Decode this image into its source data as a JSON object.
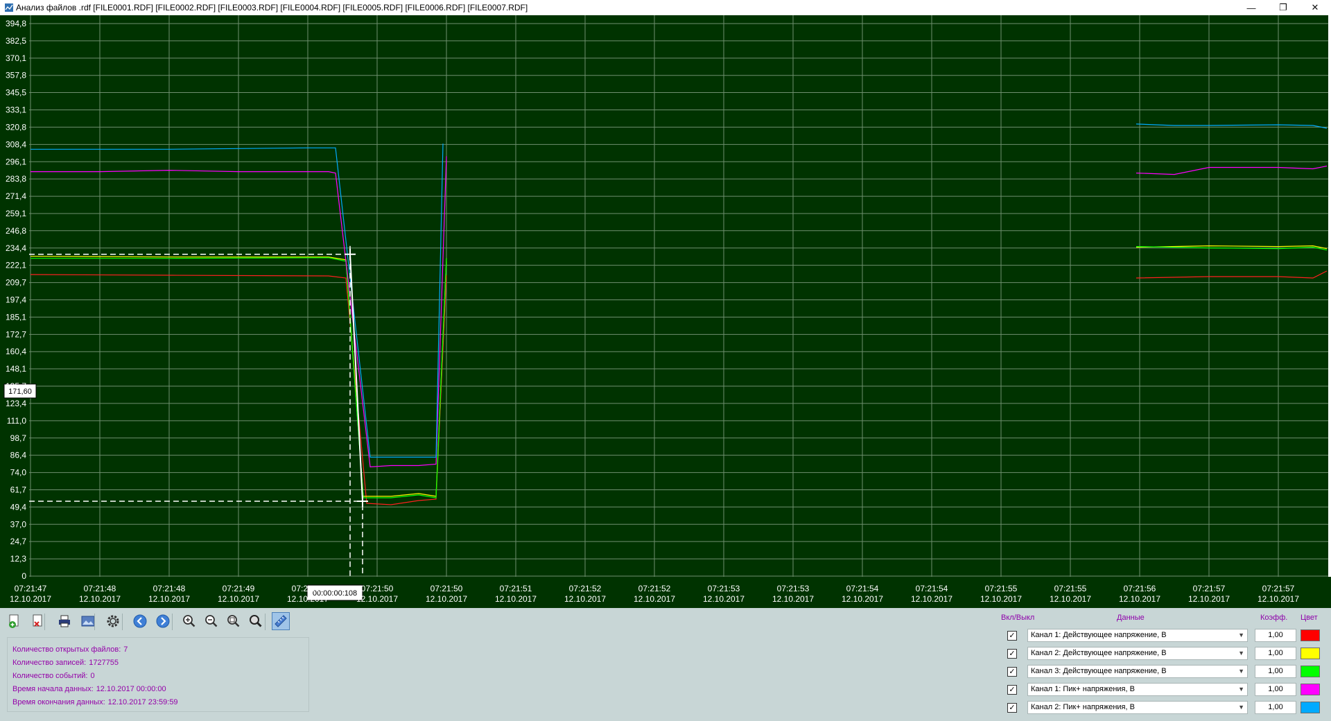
{
  "window": {
    "title": "Анализ файлов .rdf [FILE0001.RDF] [FILE0002.RDF] [FILE0003.RDF] [FILE0004.RDF] [FILE0005.RDF] [FILE0006.RDF] [FILE0007.RDF]",
    "minimize_label": "—",
    "maximize_label": "❐",
    "close_label": "✕"
  },
  "cursor": {
    "y_readout": "171,60",
    "time_readout": "00:00:00:108"
  },
  "chart_data": {
    "type": "line",
    "title": "",
    "xlabel": "",
    "ylabel": "",
    "background": "#003300",
    "grid": true,
    "ylim": [
      0,
      400
    ],
    "y_ticks": [
      "394,8",
      "382,5",
      "370,1",
      "357,8",
      "345,5",
      "333,1",
      "320,8",
      "308,4",
      "296,1",
      "283,8",
      "271,4",
      "259,1",
      "246,8",
      "234,4",
      "222,1",
      "209,7",
      "197,4",
      "185,1",
      "172,7",
      "160,4",
      "148,1",
      "135,7",
      "123,4",
      "111,0",
      "98,7",
      "86,4",
      "74,0",
      "61,7",
      "49,4",
      "37,0",
      "24,7",
      "12,3",
      "0"
    ],
    "x_ticks": [
      {
        "time": "07:21:47",
        "date": "12.10.2017"
      },
      {
        "time": "07:21:48",
        "date": "12.10.2017"
      },
      {
        "time": "07:21:48",
        "date": "12.10.2017"
      },
      {
        "time": "07:21:49",
        "date": "12.10.2017"
      },
      {
        "time": "07:21:49",
        "date": "12.10.2017"
      },
      {
        "time": "07:21:50",
        "date": "12.10.2017"
      },
      {
        "time": "07:21:50",
        "date": "12.10.2017"
      },
      {
        "time": "07:21:51",
        "date": "12.10.2017"
      },
      {
        "time": "07:21:52",
        "date": "12.10.2017"
      },
      {
        "time": "07:21:52",
        "date": "12.10.2017"
      },
      {
        "time": "07:21:53",
        "date": "12.10.2017"
      },
      {
        "time": "07:21:53",
        "date": "12.10.2017"
      },
      {
        "time": "07:21:54",
        "date": "12.10.2017"
      },
      {
        "time": "07:21:54",
        "date": "12.10.2017"
      },
      {
        "time": "07:21:55",
        "date": "12.10.2017"
      },
      {
        "time": "07:21:55",
        "date": "12.10.2017"
      },
      {
        "time": "07:21:56",
        "date": "12.10.2017"
      },
      {
        "time": "07:21:57",
        "date": "12.10.2017"
      },
      {
        "time": "07:21:57",
        "date": "12.10.2017"
      }
    ],
    "x_unit": "tick index",
    "series": [
      {
        "channel": "ch1-rms",
        "color": "#ff2020",
        "segments": [
          [
            [
              0,
              215.5
            ],
            [
              2,
              215
            ],
            [
              4.3,
              214.5
            ],
            [
              4.55,
              213
            ],
            [
              4.85,
              52
            ],
            [
              5.2,
              51
            ],
            [
              5.6,
              54
            ],
            [
              5.85,
              55
            ],
            [
              6.0,
              215
            ]
          ],
          [
            [
              15.95,
              213
            ],
            [
              17,
              214
            ],
            [
              18,
              214
            ],
            [
              18.5,
              213
            ],
            [
              18.7,
              218
            ]
          ]
        ]
      },
      {
        "channel": "ch2-rms",
        "color": "#ffff00",
        "segments": [
          [
            [
              0,
              228.5
            ],
            [
              2,
              228
            ],
            [
              4.3,
              228
            ],
            [
              4.55,
              226
            ],
            [
              4.8,
              57
            ],
            [
              5.2,
              57
            ],
            [
              5.6,
              59
            ],
            [
              5.85,
              57
            ],
            [
              6.0,
              227
            ]
          ],
          [
            [
              15.95,
              235
            ],
            [
              17,
              236
            ],
            [
              18,
              235.5
            ],
            [
              18.5,
              236
            ],
            [
              18.7,
              234
            ]
          ]
        ]
      },
      {
        "channel": "ch3-rms",
        "color": "#00ff00",
        "segments": [
          [
            [
              0,
              227
            ],
            [
              2,
              227
            ],
            [
              4.3,
              227.5
            ],
            [
              4.55,
              225
            ],
            [
              4.8,
              56
            ],
            [
              5.2,
              56
            ],
            [
              5.6,
              58
            ],
            [
              5.85,
              56
            ],
            [
              6.0,
              227
            ]
          ],
          [
            [
              15.95,
              235.5
            ],
            [
              17,
              234.5
            ],
            [
              18,
              234
            ],
            [
              18.5,
              235
            ],
            [
              18.7,
              233
            ]
          ]
        ]
      },
      {
        "channel": "ch1-peak",
        "color": "#ff00ff",
        "segments": [
          [
            [
              0,
              289
            ],
            [
              1,
              289
            ],
            [
              2,
              290
            ],
            [
              3,
              289
            ],
            [
              4.3,
              289
            ],
            [
              4.4,
              288
            ],
            [
              4.9,
              78
            ],
            [
              5.2,
              79
            ],
            [
              5.6,
              79
            ],
            [
              5.85,
              80
            ],
            [
              6.0,
              300
            ]
          ],
          [
            [
              15.95,
              288
            ],
            [
              16.5,
              287
            ],
            [
              17,
              292
            ],
            [
              18,
              292
            ],
            [
              18.5,
              291
            ],
            [
              18.7,
              293
            ]
          ]
        ]
      },
      {
        "channel": "ch2-peak",
        "color": "#00aaff",
        "segments": [
          [
            [
              0,
              305
            ],
            [
              1,
              305
            ],
            [
              2,
              305
            ],
            [
              3,
              305.5
            ],
            [
              4.0,
              306
            ],
            [
              4.4,
              306
            ],
            [
              4.9,
              85
            ],
            [
              5.2,
              85
            ],
            [
              5.6,
              85
            ],
            [
              5.85,
              85
            ],
            [
              5.95,
              309
            ]
          ],
          [
            [
              15.95,
              323
            ],
            [
              16.5,
              322
            ],
            [
              17,
              322
            ],
            [
              18,
              322.5
            ],
            [
              18.5,
              322
            ],
            [
              18.7,
              320
            ]
          ]
        ]
      }
    ],
    "cursor": {
      "x": 4.61,
      "x2": 4.79,
      "y_high": 230,
      "y_low": 53.5
    }
  },
  "toolbar": {
    "buttons": [
      {
        "name": "add-file-button",
        "icon": "add-file-icon"
      },
      {
        "name": "remove-file-button",
        "icon": "remove-file-icon"
      },
      {
        "name": "print-button",
        "icon": "printer-icon"
      },
      {
        "name": "export-image-button",
        "icon": "image-icon"
      },
      {
        "name": "settings-button",
        "icon": "gear-icon"
      },
      {
        "name": "back-button",
        "icon": "arrow-left-icon"
      },
      {
        "name": "forward-button",
        "icon": "arrow-right-icon"
      },
      {
        "name": "zoom-in-button",
        "icon": "zoom-in-icon"
      },
      {
        "name": "zoom-out-button",
        "icon": "zoom-out-icon"
      },
      {
        "name": "zoom-fit-button",
        "icon": "zoom-fit-icon"
      },
      {
        "name": "zoom-reset-button",
        "icon": "zoom-icon"
      },
      {
        "name": "measure-tool-button",
        "icon": "ruler-icon"
      }
    ]
  },
  "info": {
    "files_open_label": "Количество открытых файлов:",
    "files_open": "7",
    "records_label": "Количество записей:",
    "records": "1727755",
    "events_label": "Количество событий:",
    "events": "0",
    "start_label": "Время начала данных:",
    "start": "12.10.2017 00:00:00",
    "end_label": "Время окончания данных:",
    "end": "12.10.2017 23:59:59"
  },
  "channels": {
    "header_toggle": "Вкл/Выкл",
    "header_data": "Данные",
    "header_coef": "Коэфф.",
    "header_color": "Цвет",
    "rows": [
      {
        "label": "Канал 1: Действующее напряжение, В",
        "coef": "1,00",
        "color": "#ff0000",
        "checked": "✓"
      },
      {
        "label": "Канал 2: Действующее напряжение, В",
        "coef": "1,00",
        "color": "#ffff00",
        "checked": "✓"
      },
      {
        "label": "Канал 3: Действующее напряжение, В",
        "coef": "1,00",
        "color": "#00ff00",
        "checked": "✓"
      },
      {
        "label": "Канал 1: Пик+ напряжения, В",
        "coef": "1,00",
        "color": "#ff00ff",
        "checked": "✓"
      },
      {
        "label": "Канал 2: Пик+ напряжения, В",
        "coef": "1,00",
        "color": "#00aaff",
        "checked": "✓"
      }
    ]
  }
}
